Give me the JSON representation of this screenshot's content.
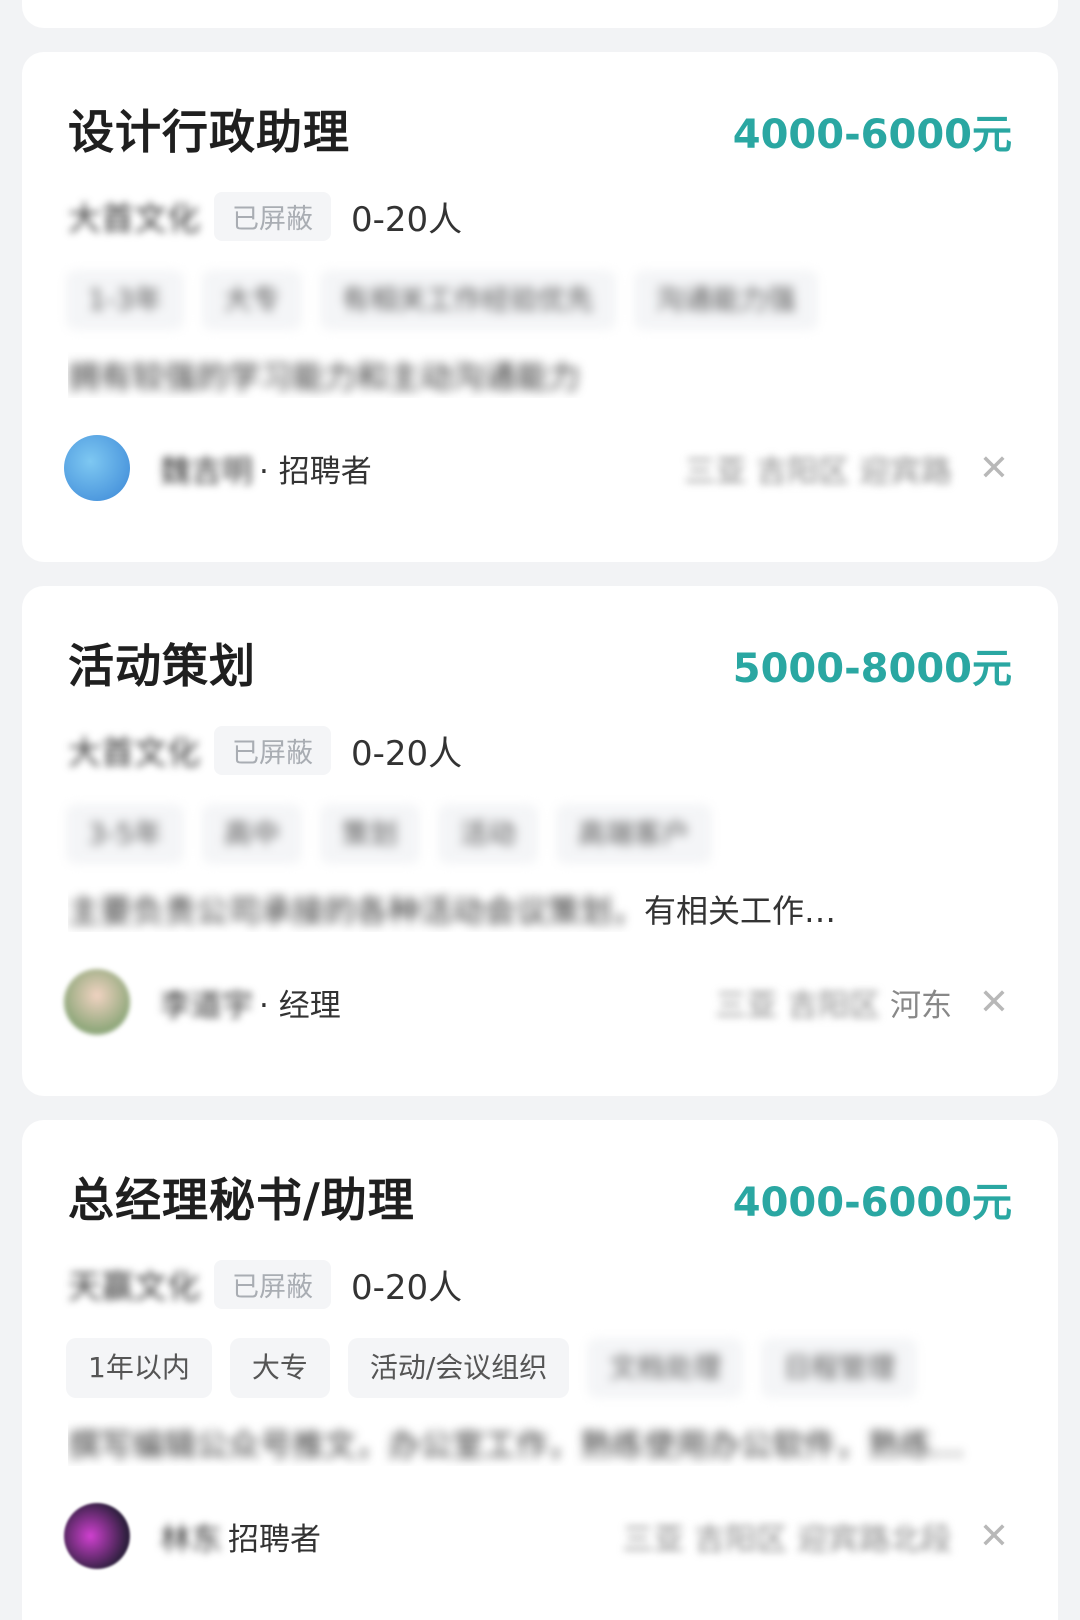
{
  "jobs": [
    {
      "title": "设计行政助理",
      "salary": "4000-6000元",
      "company": "大首文化",
      "badge": "已屏蔽",
      "size": "0-20人",
      "tags": [
        "1-3年",
        "大专",
        "有相关工作经验优先",
        "沟通能力强"
      ],
      "description": "拥有较强的学习能力和主动沟通能力",
      "recruiter_name": "魏吉明",
      "recruiter_title": "· 招聘者",
      "location_blurred": "三亚 吉阳区 迎宾路",
      "location_clear": ""
    },
    {
      "title": "活动策划",
      "salary": "5000-8000元",
      "company": "大首文化",
      "badge": "已屏蔽",
      "size": "0-20人",
      "tags": [
        "3-5年",
        "高中",
        "策划",
        "活动",
        "高端客户"
      ],
      "description_blurred": "主要负责公司承接的各种活动会议策划，",
      "description_clear": "有相关工作…",
      "recruiter_name": "李道宇",
      "recruiter_title": "· 经理",
      "location_blurred": "三亚 吉阳区",
      "location_clear": "河东"
    },
    {
      "title": "总经理秘书/助理",
      "salary": "4000-6000元",
      "company": "天赢文化",
      "badge": "已屏蔽",
      "size": "0-20人",
      "tags_clear": [
        "1年以内",
        "大专",
        "活动/会议组织"
      ],
      "tags_blurred": [
        "文档处理",
        "日程管理"
      ],
      "description": "撰写编辑公众号推文，办公室工作，熟练使用办公软件，熟练…",
      "recruiter_name": "林东",
      "recruiter_title": "招聘者",
      "location_blurred": "三亚 吉阳区 迎宾路北段",
      "location_clear": ""
    }
  ]
}
